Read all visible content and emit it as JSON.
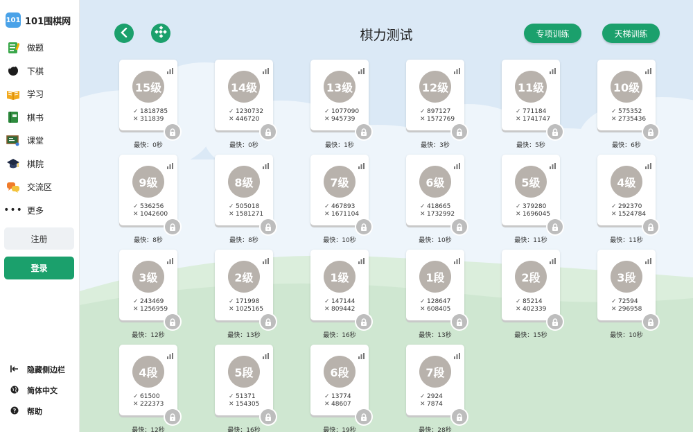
{
  "brand": {
    "logo_text": "101",
    "name": "101围棋网"
  },
  "nav": [
    {
      "label": "做题",
      "icon": "exercise-book-icon"
    },
    {
      "label": "下棋",
      "icon": "go-stone-icon"
    },
    {
      "label": "学习",
      "icon": "open-book-icon"
    },
    {
      "label": "棋书",
      "icon": "green-book-icon"
    },
    {
      "label": "课堂",
      "icon": "classroom-board-icon"
    },
    {
      "label": "棋院",
      "icon": "graduation-cap-icon"
    },
    {
      "label": "交流区",
      "icon": "chat-bubbles-icon"
    },
    {
      "label": "更多",
      "icon": "more-dots-icon"
    }
  ],
  "auth": {
    "register": "注册",
    "login": "登录"
  },
  "side_bottom": [
    {
      "label": "隐藏侧边栏",
      "icon": "collapse-sidebar-icon"
    },
    {
      "label": "简体中文",
      "icon": "globe-icon"
    },
    {
      "label": "帮助",
      "icon": "help-icon"
    }
  ],
  "header": {
    "title": "棋力测试",
    "special_training": "专项训练",
    "ladder_training": "天梯训练"
  },
  "colors": {
    "accent": "#1ba06c",
    "badge": "#b8b2ac",
    "lock": "#bdbdbd"
  },
  "levels": [
    {
      "rank": "15级",
      "correct": "1818785",
      "wrong": "311839",
      "best": "最快：0秒"
    },
    {
      "rank": "14级",
      "correct": "1230732",
      "wrong": "446720",
      "best": "最快：0秒"
    },
    {
      "rank": "13级",
      "correct": "1077090",
      "wrong": "945739",
      "best": "最快：1秒"
    },
    {
      "rank": "12级",
      "correct": "897127",
      "wrong": "1572769",
      "best": "最快：3秒"
    },
    {
      "rank": "11级",
      "correct": "771184",
      "wrong": "1741747",
      "best": "最快：5秒"
    },
    {
      "rank": "10级",
      "correct": "575352",
      "wrong": "2735436",
      "best": "最快：6秒"
    },
    {
      "rank": "9级",
      "correct": "536256",
      "wrong": "1042600",
      "best": "最快：8秒"
    },
    {
      "rank": "8级",
      "correct": "505018",
      "wrong": "1581271",
      "best": "最快：8秒"
    },
    {
      "rank": "7级",
      "correct": "467893",
      "wrong": "1671104",
      "best": "最快：10秒"
    },
    {
      "rank": "6级",
      "correct": "418665",
      "wrong": "1732992",
      "best": "最快：10秒"
    },
    {
      "rank": "5级",
      "correct": "379280",
      "wrong": "1696045",
      "best": "最快：11秒"
    },
    {
      "rank": "4级",
      "correct": "292370",
      "wrong": "1524784",
      "best": "最快：11秒"
    },
    {
      "rank": "3级",
      "correct": "243469",
      "wrong": "1256959",
      "best": "最快：12秒"
    },
    {
      "rank": "2级",
      "correct": "171998",
      "wrong": "1025165",
      "best": "最快：13秒"
    },
    {
      "rank": "1级",
      "correct": "147144",
      "wrong": "809442",
      "best": "最快：16秒"
    },
    {
      "rank": "1段",
      "correct": "128647",
      "wrong": "608405",
      "best": "最快：13秒"
    },
    {
      "rank": "2段",
      "correct": "85214",
      "wrong": "402339",
      "best": "最快：15秒"
    },
    {
      "rank": "3段",
      "correct": "72594",
      "wrong": "296958",
      "best": "最快：10秒"
    },
    {
      "rank": "4段",
      "correct": "61500",
      "wrong": "222373",
      "best": "最快：12秒"
    },
    {
      "rank": "5段",
      "correct": "51371",
      "wrong": "154305",
      "best": "最快：16秒"
    },
    {
      "rank": "6段",
      "correct": "13774",
      "wrong": "48607",
      "best": "最快：19秒"
    },
    {
      "rank": "7段",
      "correct": "2924",
      "wrong": "7874",
      "best": "最快：28秒"
    }
  ]
}
